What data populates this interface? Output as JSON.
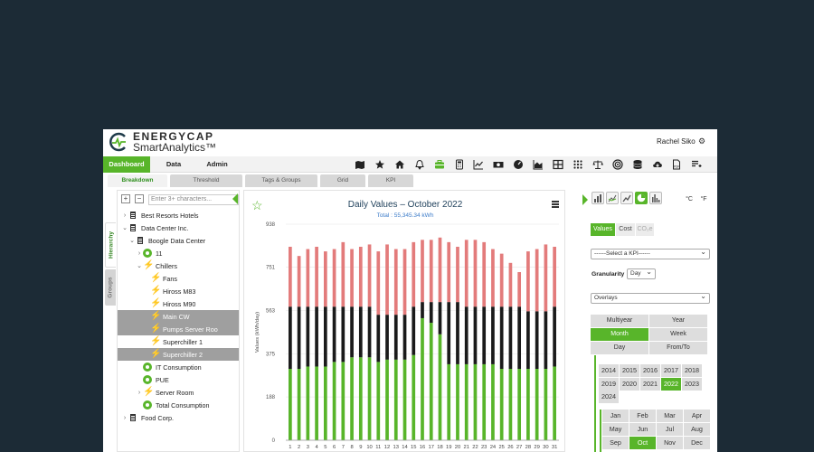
{
  "brand": {
    "line1": "ENERGYCAP",
    "line2": "SmartAnalytics™"
  },
  "user": {
    "name": "Rachel Siko",
    "icon": "gears-icon"
  },
  "topnav": [
    "Dashboard",
    "Data",
    "Admin"
  ],
  "toolbar_icons": [
    "map-icon",
    "star-icon",
    "home-icon",
    "bell-icon",
    "briefcase-icon",
    "calculator-icon",
    "line-chart-icon",
    "money-icon",
    "gauge-icon",
    "area-chart-icon",
    "table-icon",
    "grid-icon",
    "scales-icon",
    "target-icon",
    "database-icon",
    "cloud-download-icon",
    "pdf-icon",
    "add-list-icon"
  ],
  "subtabs": [
    "Breakdown",
    "Threshold",
    "Tags & Groups",
    "Grid",
    "KPI"
  ],
  "side_tabs": [
    "Hierarchy",
    "Groups"
  ],
  "tree": {
    "placeholder": "Enter 3+ characters...",
    "items": [
      {
        "label": "Best Resorts Hotels",
        "icon": "building-icon"
      },
      {
        "label": "Data Center Inc.",
        "icon": "building-icon"
      },
      {
        "label": "Boogle Data Center",
        "icon": "building-icon"
      },
      {
        "label": "11",
        "icon": "meter-icon"
      },
      {
        "label": "Chillers",
        "icon": "bolt-icon"
      },
      {
        "label": "Fans",
        "icon": "bolt-icon"
      },
      {
        "label": "Hiross M83",
        "icon": "bolt-icon"
      },
      {
        "label": "Hiross M90",
        "icon": "bolt-icon"
      },
      {
        "label": "Main CW",
        "icon": "bolt-icon",
        "selected": true
      },
      {
        "label": "Pumps Server Roo",
        "icon": "bolt-icon",
        "selected": true
      },
      {
        "label": "Superchiller 1",
        "icon": "bolt-icon"
      },
      {
        "label": "Superchiller 2",
        "icon": "bolt-icon",
        "selected": true
      },
      {
        "label": "IT Consumption",
        "icon": "meter-icon"
      },
      {
        "label": "PUE",
        "icon": "meter-icon"
      },
      {
        "label": "Server Room",
        "icon": "bolt-icon"
      },
      {
        "label": "Total Consumption",
        "icon": "meter-icon"
      },
      {
        "label": "Food Corp.",
        "icon": "building-icon"
      }
    ]
  },
  "chart_data": {
    "type": "bar",
    "title": "Daily Values – October 2022",
    "subtitle": "Total : 55,345.34 kWh",
    "ylabel": "Values (kWh/day)",
    "ylim": [
      0,
      938
    ],
    "yticks": [
      0,
      188,
      375,
      563,
      751,
      938
    ],
    "categories": [
      "1",
      "2",
      "3",
      "4",
      "5",
      "6",
      "7",
      "8",
      "9",
      "10",
      "11",
      "12",
      "13",
      "14",
      "15",
      "16",
      "17",
      "18",
      "19",
      "20",
      "21",
      "22",
      "23",
      "24",
      "25",
      "26",
      "27",
      "28",
      "29",
      "30",
      "31"
    ],
    "colors": [
      "#58b52a",
      "#1a1a1a",
      "#e37b7b"
    ],
    "series": [
      {
        "values": [
          310,
          310,
          320,
          320,
          320,
          340,
          340,
          360,
          360,
          360,
          340,
          350,
          350,
          350,
          370,
          530,
          510,
          460,
          330,
          330,
          330,
          330,
          330,
          330,
          310,
          310,
          310,
          310,
          310,
          310,
          320
        ]
      },
      {
        "values": [
          580,
          580,
          580,
          580,
          580,
          580,
          580,
          580,
          580,
          580,
          545,
          545,
          545,
          545,
          580,
          600,
          600,
          600,
          600,
          600,
          580,
          580,
          580,
          580,
          580,
          580,
          580,
          560,
          560,
          560,
          580
        ]
      },
      {
        "values": [
          840,
          800,
          830,
          840,
          820,
          830,
          860,
          830,
          840,
          850,
          820,
          850,
          830,
          830,
          860,
          870,
          870,
          880,
          860,
          840,
          870,
          870,
          860,
          830,
          810,
          770,
          730,
          820,
          830,
          850,
          840
        ]
      }
    ]
  },
  "right": {
    "chart_types": [
      "bar-chart-icon",
      "multi-line-icon",
      "line-icon",
      "pie-chart-icon",
      "histogram-icon"
    ],
    "units": [
      "°C",
      "°F"
    ],
    "value_tabs": [
      "Values",
      "Cost",
      "CO₂e"
    ],
    "kpi_placeholder": "------Select a KPI------",
    "granularity_label": "Granularity",
    "granularity_value": "Day",
    "overlays": "Overlays",
    "periods": [
      "Multiyear",
      "Year",
      "Month",
      "Week",
      "Day",
      "From/To"
    ],
    "active_period": "Month",
    "years": [
      "2014",
      "2015",
      "2016",
      "2017",
      "2018",
      "2019",
      "2020",
      "2021",
      "2022",
      "2023",
      "2024"
    ],
    "active_year": "2022",
    "months": [
      "Jan",
      "Feb",
      "Mar",
      "Apr",
      "May",
      "Jun",
      "Jul",
      "Aug",
      "Sep",
      "Oct",
      "Nov",
      "Dec"
    ],
    "active_month": "Oct"
  }
}
